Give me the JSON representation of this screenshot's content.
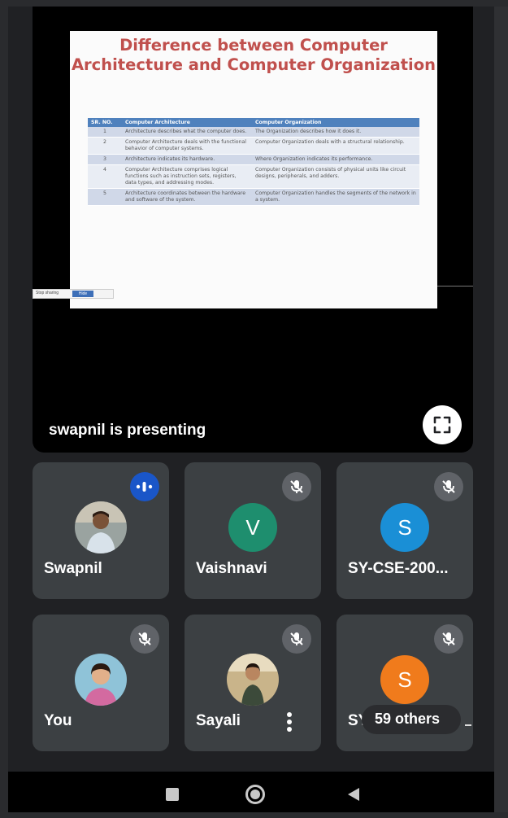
{
  "presentation": {
    "presenter_text": "swapnil is presenting",
    "slide": {
      "title": "Difference between Computer Architecture and Computer Organization",
      "table": {
        "headers": [
          "SR. NO.",
          "Computer Architecture",
          "Computer Organization"
        ],
        "rows": [
          [
            "1",
            "Architecture describes what the computer does.",
            "The Organization describes how it does it."
          ],
          [
            "2",
            "Computer Architecture deals with the functional behavior of computer systems.",
            "Computer Organization deals with a structural relationship."
          ],
          [
            "3",
            "Architecture indicates its hardware.",
            "Where Organization indicates its performance."
          ],
          [
            "4",
            "Computer Architecture comprises logical functions such as instruction sets, registers, data types, and addressing modes.",
            "Computer Organization consists of physical units like circuit designs, peripherals, and adders."
          ],
          [
            "5",
            "Architecture coordinates between the hardware and software of the system.",
            "Computer Organization handles the segments of the network in a system."
          ]
        ]
      }
    },
    "overlay_toolbar": {
      "label": "Stop sharing",
      "button": "Hide"
    }
  },
  "participants": [
    {
      "name": "Swapnil",
      "avatar": "photo",
      "status": "speaking"
    },
    {
      "name": "Vaishnavi",
      "avatar_letter": "V",
      "avatar_color": "#1e8e6e",
      "status": "muted"
    },
    {
      "name": "SY-CSE-200...",
      "avatar_letter": "S",
      "avatar_color": "#1a8fd6",
      "status": "muted"
    },
    {
      "name": "You",
      "avatar": "photo",
      "status": "muted"
    },
    {
      "name": "Sayali",
      "avatar": "photo",
      "status": "muted"
    },
    {
      "name": "SY-CSE-200...",
      "avatar_letter": "S",
      "avatar_color": "#f07b1c",
      "status": "muted"
    }
  ],
  "others": {
    "label": "59 others"
  },
  "icons": {
    "fullscreen": "fullscreen-icon",
    "mute": "mic-off-icon",
    "speaking": "audio-level-icon",
    "more": "more-vert-icon",
    "nav_recents": "recents-icon",
    "nav_home": "home-icon",
    "nav_back": "back-icon"
  }
}
